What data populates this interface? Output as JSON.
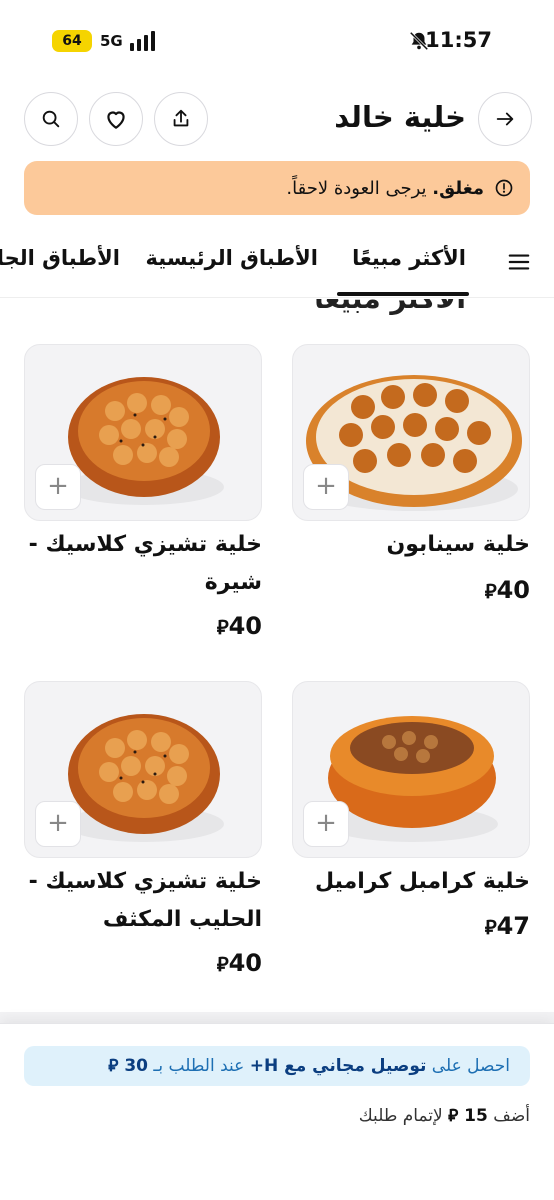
{
  "status_bar": {
    "time": "11:57",
    "battery": "64",
    "network": "5G"
  },
  "header": {
    "title": "خلية خالد",
    "back_icon": "arrow-right-icon",
    "search_icon": "search-icon",
    "favorite_icon": "heart-icon",
    "share_icon": "share-icon"
  },
  "closed_notice": {
    "status": "مغلق.",
    "message": "يرجى العودة لاحقاً."
  },
  "tabs": [
    {
      "label": "الأكثر مبيعًا",
      "active": true
    },
    {
      "label": "الأطباق الرئيسية",
      "active": false
    },
    {
      "label": "الأطباق الجا",
      "active": false
    }
  ],
  "section_title": "الأكثر مبيعًا",
  "products": [
    {
      "name": "خلية سينابون",
      "price": "40",
      "currency": "⃁"
    },
    {
      "name": "خلية تشيزي كلاسيك - شيرة",
      "price": "40",
      "currency": "⃁"
    },
    {
      "name": "خلية كرامبل كراميل",
      "price": "47",
      "currency": "⃁"
    },
    {
      "name": "خلية تشيزي كلاسيك - الحليب المكثف",
      "price": "40",
      "currency": "⃁"
    }
  ],
  "add_button_label": "+",
  "promo": {
    "prefix": "احصل على",
    "highlight": "توصيل مجاني مع H+",
    "suffix": "عند الطلب بـ",
    "amount": "30",
    "currency": "⃁"
  },
  "min_order": {
    "prefix": "أضف",
    "amount": "15",
    "currency": "⃁",
    "suffix": "لإتمام طلبك"
  },
  "colors": {
    "closed_banner": "#fcc99a",
    "promo_bg": "#dff1fb",
    "promo_text": "#1d6fb3"
  }
}
